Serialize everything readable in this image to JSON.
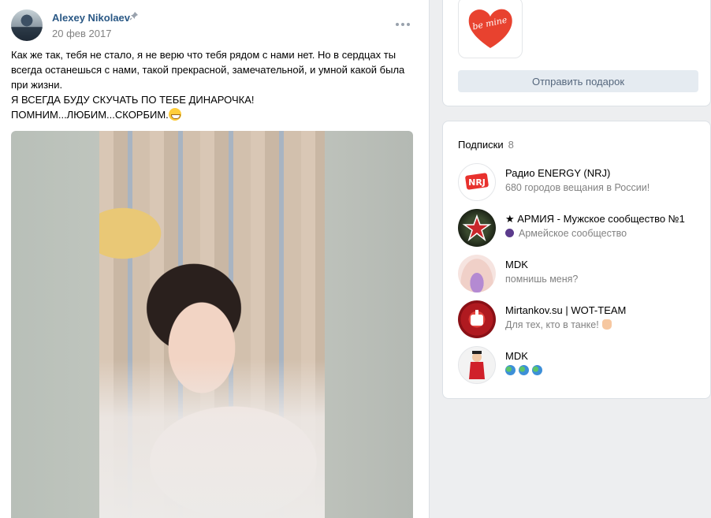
{
  "post": {
    "author": "Alexey Nikolaev",
    "date": "20 фев 2017",
    "text_lines": [
      "Как же так, тебя не стало, я не верю что тебя рядом с нами нет. Но в сердцах ты всегда останешься с нами, такой прекрасной, замечательной, и умной какой была при жизни.",
      "Я ВСЕГДА БУДУ СКУЧАТЬ ПО ТЕБЕ ДИНАРОЧКА!",
      "ПОМНИМ...ЛЮБИМ...СКОРБИМ."
    ]
  },
  "gift": {
    "image_text": "be mine",
    "button_label": "Отправить подарок"
  },
  "subscriptions": {
    "title": "Подписки",
    "count": "8",
    "items": [
      {
        "name": "Радио ENERGY (NRJ)",
        "desc": "680 городов вещания в России!",
        "avatar_color": "#e8312d",
        "avatar_text": "NRJ"
      },
      {
        "name": "★ АРМИЯ - Мужское сообщество №1",
        "desc": "Армейское сообщество",
        "avatar_color": "#2c3a24",
        "avatar_text": "★"
      },
      {
        "name": "MDK",
        "desc": "помнишь меня?",
        "avatar_color": "#f0d6d6",
        "avatar_text": ""
      },
      {
        "name": "Mirtankov.su | WOT-TEAM",
        "desc": "Для тех, кто в танке!",
        "avatar_color": "#c41e24",
        "avatar_text": ""
      },
      {
        "name": "MDK",
        "desc": "",
        "avatar_color": "#f3f3f3",
        "avatar_text": ""
      }
    ]
  },
  "colors": {
    "link": "#2a5885",
    "muted": "#828282",
    "button_bg": "#e5ebf1",
    "button_text": "#55677d",
    "page_bg": "#edeef0"
  },
  "icons": [
    "pin-icon",
    "more-icon",
    "smile-icon",
    "globe-icon",
    "bomb-icon",
    "hand-icon"
  ]
}
